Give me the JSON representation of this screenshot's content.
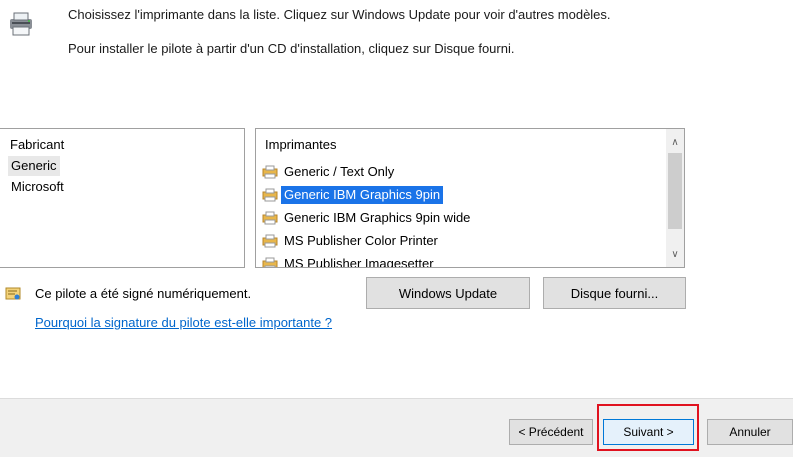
{
  "instructions": {
    "line1": "Choisissez l'imprimante dans la liste. Cliquez sur Windows Update pour voir d'autres modèles.",
    "line2": "Pour installer le pilote à partir d'un CD d'installation, cliquez sur Disque fourni."
  },
  "manufacturers": {
    "header": "Fabricant",
    "items": [
      "Generic",
      "Microsoft"
    ],
    "selected": "Generic"
  },
  "printers": {
    "header": "Imprimantes",
    "items": [
      "Generic / Text Only",
      "Generic IBM Graphics 9pin",
      "Generic IBM Graphics 9pin wide",
      "MS Publisher Color Printer",
      "MS Publisher Imagesetter"
    ],
    "selected": "Generic IBM Graphics 9pin"
  },
  "signature": {
    "status": "Ce pilote a été signé numériquement.",
    "link": "Pourquoi la signature du pilote est-elle importante ?"
  },
  "buttons": {
    "windows_update": "Windows Update",
    "have_disk": "Disque fourni...",
    "back": "< Précédent",
    "next": "Suivant >",
    "cancel": "Annuler"
  },
  "colors": {
    "selection": "#1a73e8",
    "link": "#0066cc",
    "highlight": "#e0121f"
  },
  "icons": {
    "header": "printer-setup-icon",
    "printer": "printer-icon",
    "certificate": "certificate-icon"
  }
}
